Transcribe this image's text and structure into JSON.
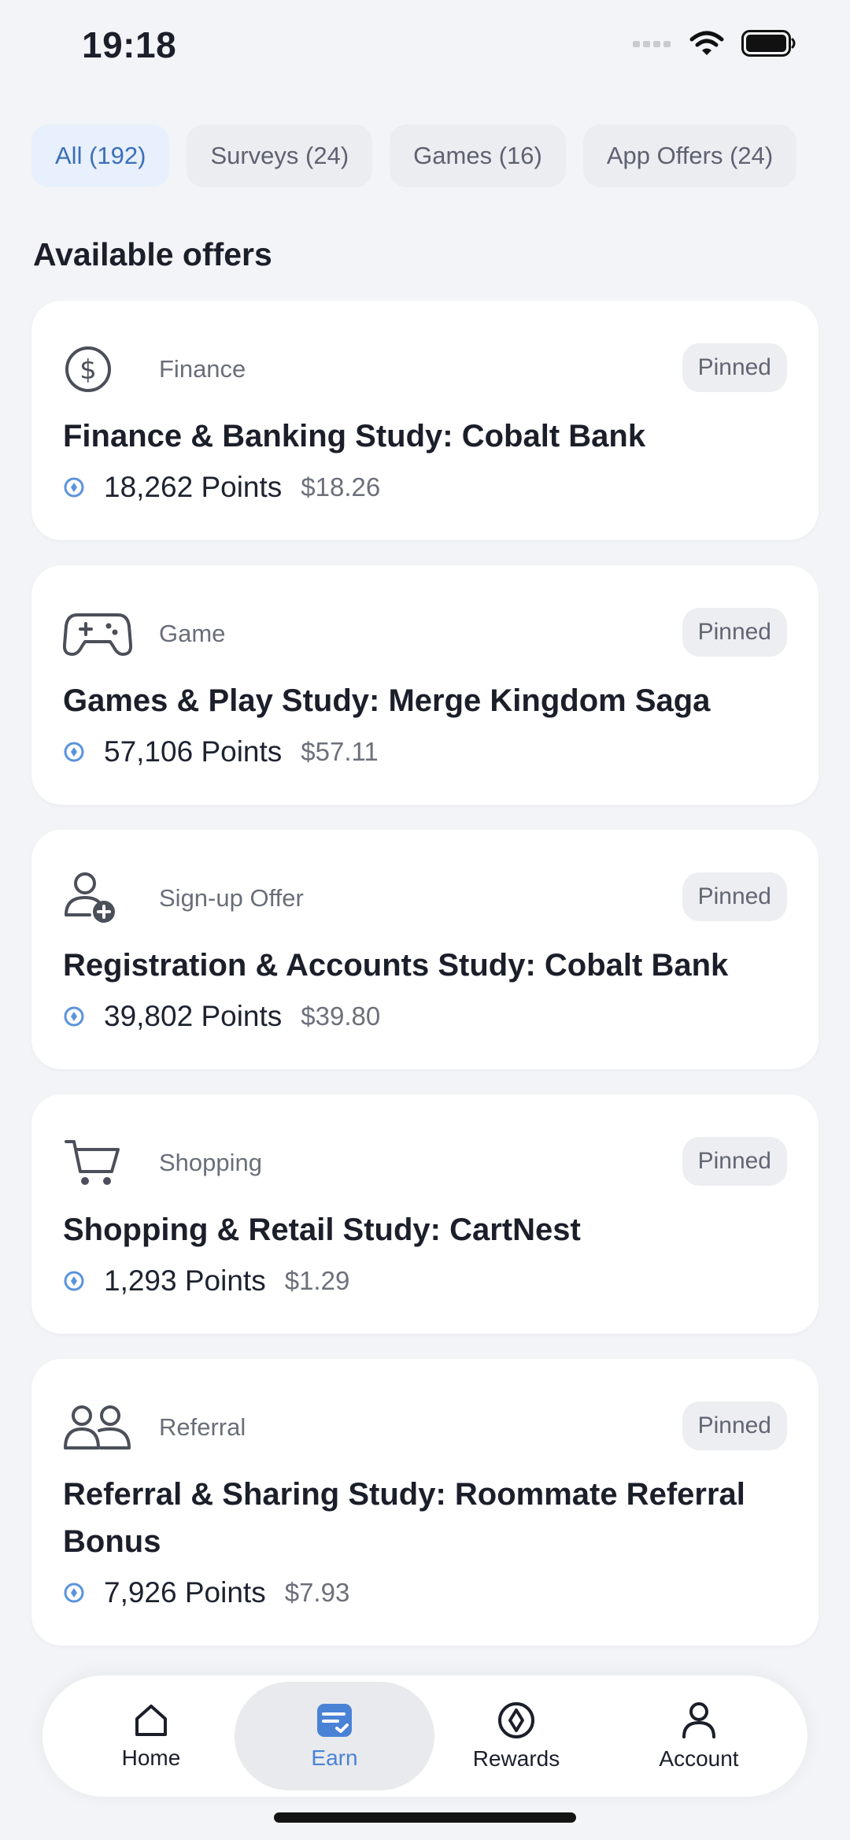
{
  "status_bar": {
    "time": "19:18"
  },
  "filters": [
    {
      "label": "All (192)",
      "active": true
    },
    {
      "label": "Surveys (24)",
      "active": false
    },
    {
      "label": "Games (16)",
      "active": false
    },
    {
      "label": "App Offers (24)",
      "active": false
    }
  ],
  "section_title": "Available offers",
  "offers": [
    {
      "category": "Finance",
      "icon": "dollar-circle-icon",
      "badge": "Pinned",
      "title": "Finance & Banking Study: Cobalt Bank",
      "points": "18,262 Points",
      "cash": "$18.26"
    },
    {
      "category": "Game",
      "icon": "gamepad-icon",
      "badge": "Pinned",
      "title": "Games & Play Study: Merge Kingdom Saga",
      "points": "57,106 Points",
      "cash": "$57.11"
    },
    {
      "category": "Sign-up Offer",
      "icon": "user-add-icon",
      "badge": "Pinned",
      "title": "Registration & Accounts Study: Cobalt Bank",
      "points": "39,802 Points",
      "cash": "$39.80"
    },
    {
      "category": "Shopping",
      "icon": "cart-icon",
      "badge": "Pinned",
      "title": "Shopping & Retail Study: CartNest",
      "points": "1,293 Points",
      "cash": "$1.29"
    },
    {
      "category": "Referral",
      "icon": "users-icon",
      "badge": "Pinned",
      "title": "Referral & Sharing Study: Roommate Referral Bonus",
      "points": "7,926 Points",
      "cash": "$7.93"
    }
  ],
  "bottom_nav": {
    "home": "Home",
    "earn": "Earn",
    "rewards": "Rewards",
    "account": "Account"
  },
  "colors": {
    "accent": "#4a83d6",
    "background": "#f3f4f7",
    "chip_active_bg": "#e7f0fc"
  }
}
